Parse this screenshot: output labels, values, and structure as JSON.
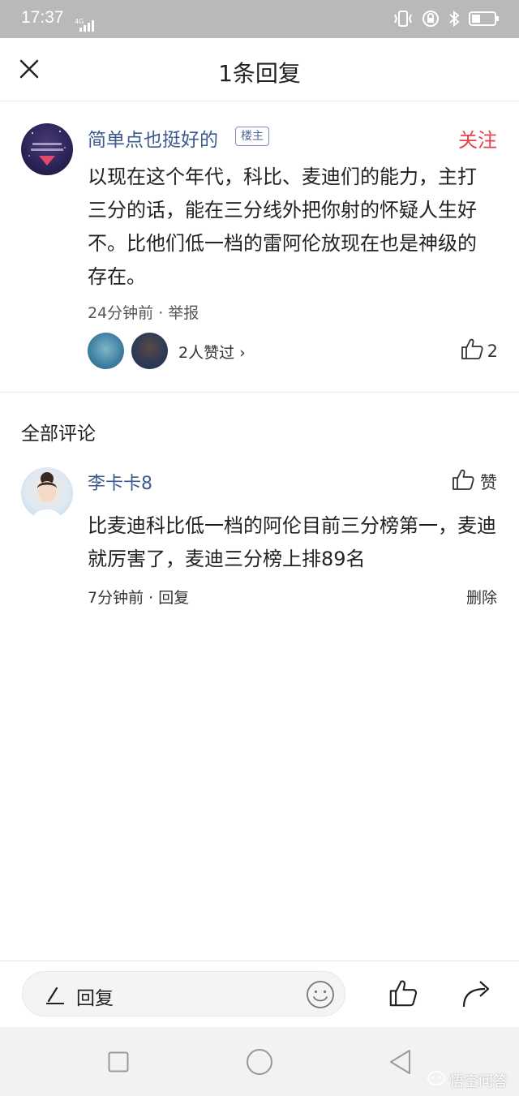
{
  "status_bar": {
    "time": "17:37",
    "network": "4G"
  },
  "header": {
    "title": "1条回复",
    "close_icon": "close-icon"
  },
  "post": {
    "author": "简单点也挺好的",
    "badge": "楼主",
    "follow_label": "关注",
    "text": "以现在这个年代，科比、麦迪们的能力，主打三分的话，能在三分线外把你射的怀疑人生好不。比他们低一档的雷阿伦放现在也是神级的存在。",
    "meta": "24分钟前 · 举报",
    "likers_text": "2人赞过 ›",
    "like_count": "2"
  },
  "comments_section": {
    "title": "全部评论",
    "items": [
      {
        "author": "李卡卡8",
        "like_label": "赞",
        "text": "比麦迪科比低一档的阿伦目前三分榜第一，麦迪就厉害了，麦迪三分榜上排89名",
        "meta": "7分钟前 · 回复",
        "delete_label": "删除"
      }
    ]
  },
  "bottom_bar": {
    "reply_placeholder": "回复"
  },
  "watermark": "悟空问答",
  "colors": {
    "link_blue": "#3d5a8e",
    "follow_red": "#e8404b",
    "status_bar_bg": "#b9b9bb"
  }
}
